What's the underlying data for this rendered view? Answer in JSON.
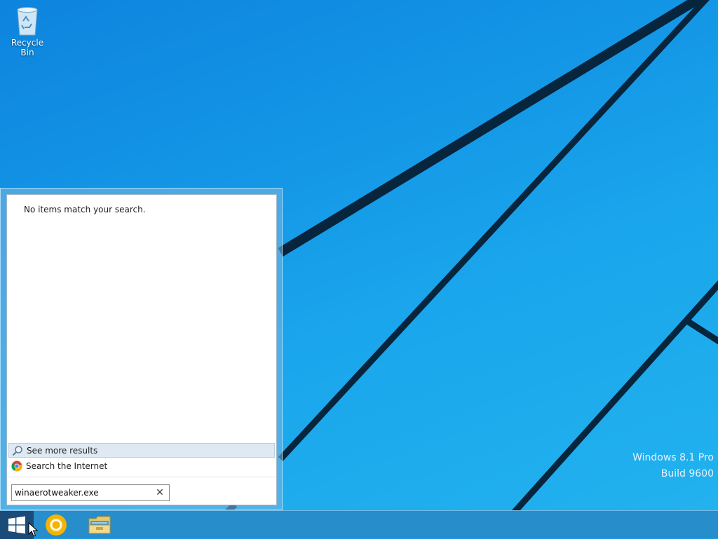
{
  "desktop": {
    "icons": [
      {
        "label": "Recycle Bin",
        "icon": "recycle-bin-icon"
      }
    ],
    "watermark": {
      "line1": "Windows 8.1 Pro",
      "line2": "Build 9600"
    }
  },
  "start_menu": {
    "no_results_text": "No items match your search.",
    "see_more_label": "See more results",
    "search_internet_label": "Search the Internet",
    "search": {
      "value": "winaerotweaker.exe",
      "clear_icon": "close-icon"
    }
  },
  "taskbar": {
    "items": [
      {
        "name": "start",
        "icon": "windows-logo-icon"
      },
      {
        "name": "chrome",
        "icon": "chrome-icon"
      },
      {
        "name": "file-explorer",
        "icon": "folder-icon"
      }
    ]
  },
  "colors": {
    "desktop_blue": "#1497e6",
    "taskbar": "#288cc8",
    "start_button": "#1b4b78"
  }
}
